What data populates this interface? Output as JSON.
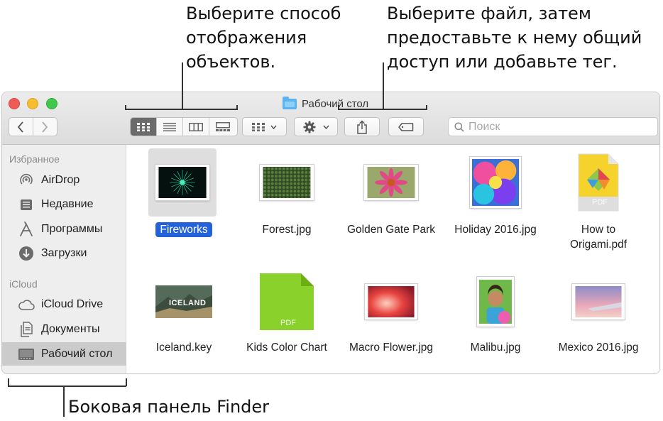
{
  "callouts": {
    "view_mode": [
      "Выберите способ",
      "отображения",
      "объектов."
    ],
    "share_tag": [
      "Выберите файл, затем",
      "предоставьте к нему общий",
      "доступ или добавьте тег."
    ],
    "sidebar": "Боковая панель Finder"
  },
  "window": {
    "title": "Рабочий стол",
    "search_placeholder": "Поиск",
    "icons": {
      "back": "chevron-left-icon",
      "forward": "chevron-right-icon",
      "view_modes": [
        "icon-view-icon",
        "list-view-icon",
        "column-view-icon",
        "gallery-view-icon"
      ],
      "group": "group-by-icon",
      "action": "gear-icon",
      "share": "share-icon",
      "tag": "tag-icon",
      "search": "search-icon"
    },
    "active_view": "icon-view"
  },
  "sidebar": {
    "favorites_heading": "Избранное",
    "favorites": [
      {
        "label": "AirDrop",
        "icon": "airdrop-icon"
      },
      {
        "label": "Недавние",
        "icon": "recents-icon"
      },
      {
        "label": "Программы",
        "icon": "applications-icon"
      },
      {
        "label": "Загрузки",
        "icon": "downloads-icon"
      }
    ],
    "icloud_heading": "iCloud",
    "icloud": [
      {
        "label": "iCloud Drive",
        "icon": "cloud-icon"
      },
      {
        "label": "Документы",
        "icon": "documents-icon"
      },
      {
        "label": "Рабочий стол",
        "icon": "desktop-icon",
        "selected": true
      }
    ]
  },
  "files": [
    {
      "label": "Fireworks",
      "selected": true
    },
    {
      "label": "Forest.jpg"
    },
    {
      "label": "Golden Gate Park"
    },
    {
      "label": "Holiday 2016.jpg"
    },
    {
      "label": "How to Origami.pdf",
      "lines": [
        "How to",
        "Origami.pdf"
      ],
      "badge": "PDF"
    },
    {
      "label": "Iceland.key",
      "thumb_text": "ICELAND"
    },
    {
      "label": "Kids Color Chart",
      "badge": "PDF"
    },
    {
      "label": "Macro Flower.jpg"
    },
    {
      "label": "Malibu.jpg"
    },
    {
      "label": "Mexico 2016.jpg"
    }
  ],
  "colors": {
    "selection": "#2362d8",
    "sidebar_bg": "#eeeeee",
    "close": "#ee5d55",
    "minimize": "#f6bd32",
    "maximize": "#3fc849"
  }
}
